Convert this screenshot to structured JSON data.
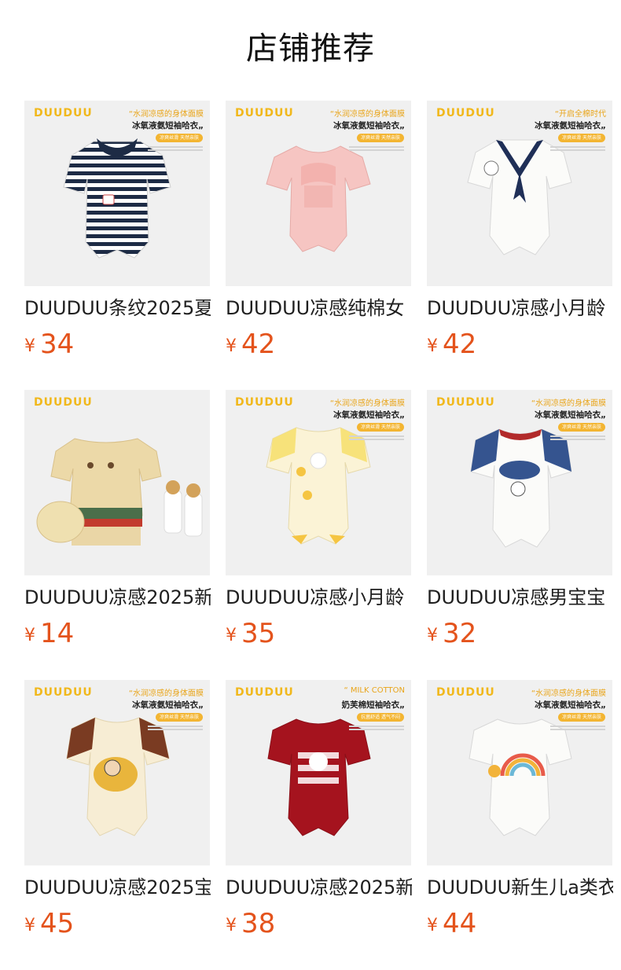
{
  "page": {
    "title": "店铺推荐"
  },
  "colors": {
    "price": "#e4531c",
    "brand": "#f1b81c",
    "thumb_bg": "#f0f0f0"
  },
  "products": [
    {
      "name": "DUUDUU条纹2025夏",
      "currency": "¥",
      "price": "34",
      "image": {
        "brand": "DUUDUU",
        "slogan": "“水润凉感的身体面膜",
        "subline": "冰氧液氨短袖哈衣„",
        "pill": "凉爽丝滑  天然亲肤",
        "garment": "navy-white-striped-romper"
      }
    },
    {
      "name": "DUUDUU凉感纯棉女",
      "currency": "¥",
      "price": "42",
      "image": {
        "brand": "DUUDUU",
        "slogan": "“水润凉感的身体面膜",
        "subline": "冰氧液氨短袖哈衣„",
        "pill": "凉爽丝滑  天然亲肤",
        "garment": "pink-bow-romper"
      }
    },
    {
      "name": "DUUDUU凉感小月龄",
      "currency": "¥",
      "price": "42",
      "image": {
        "brand": "DUUDUU",
        "slogan": "“开启全棉时代",
        "subline": "冰氧液氨短袖哈衣„",
        "pill": "凉爽丝滑  天然亲肤",
        "garment": "white-sailor-romper"
      }
    },
    {
      "name": "DUUDUU凉感2025新",
      "currency": "¥",
      "price": "14",
      "image": {
        "brand": "DUUDUU",
        "slogan": "",
        "subline": "",
        "pill": "",
        "garment": "beige-bear-romper-set"
      }
    },
    {
      "name": "DUUDUU凉感小月龄",
      "currency": "¥",
      "price": "35",
      "image": {
        "brand": "DUUDUU",
        "slogan": "“水润凉感的身体面膜",
        "subline": "冰氧液氨短袖哈衣„",
        "pill": "凉爽丝滑  天然亲肤",
        "garment": "yellow-duck-romper"
      }
    },
    {
      "name": "DUUDUU凉感男宝宝",
      "currency": "¥",
      "price": "32",
      "image": {
        "brand": "DUUDUU",
        "slogan": "“水润凉感的身体面膜",
        "subline": "冰氧液氨短袖哈衣„",
        "pill": "凉爽丝滑  天然亲肤",
        "garment": "white-raglan-dog-romper"
      }
    },
    {
      "name": "DUUDUU凉感2025宝",
      "currency": "¥",
      "price": "45",
      "image": {
        "brand": "DUUDUU",
        "slogan": "“水润凉感的身体面膜",
        "subline": "冰氧液氨短袖哈衣„",
        "pill": "凉爽丝滑  天然亲肤",
        "garment": "cream-brown-sleeve-romper"
      }
    },
    {
      "name": "DUUDUU凉感2025新",
      "currency": "¥",
      "price": "38",
      "image": {
        "brand": "DUUDUU",
        "slogan": "“ MILK COTTON",
        "subline": "奶芙棉短袖哈衣„",
        "pill": "抗菌舒适  透气不闷",
        "garment": "red-romper"
      }
    },
    {
      "name": "DUUDUU新生儿a类衣",
      "currency": "¥",
      "price": "44",
      "image": {
        "brand": "DUUDUU",
        "slogan": "“水润凉感的身体面膜",
        "subline": "冰氧液氨短袖哈衣„",
        "pill": "凉爽丝滑  天然亲肤",
        "garment": "white-rainbow-romper"
      }
    }
  ]
}
